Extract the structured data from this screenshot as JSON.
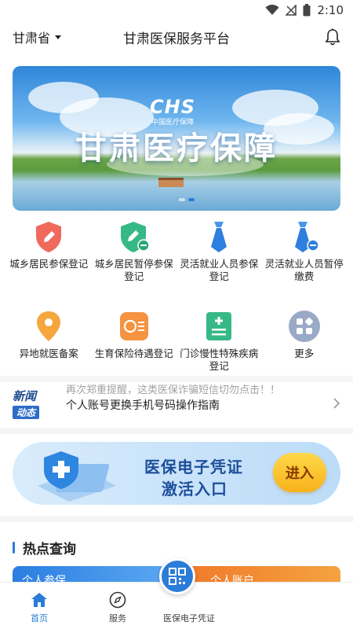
{
  "status_bar": {
    "time": "2:10"
  },
  "header": {
    "province": "甘肃省",
    "title": "甘肃医保服务平台"
  },
  "banner": {
    "logo_text": "CHS",
    "logo_subtitle": "中国医疗保障",
    "headline": "甘肃医疗保障"
  },
  "services": [
    {
      "label": "城乡居民参保登记",
      "icon": "shield-pen-icon",
      "color": "#e8564a"
    },
    {
      "label": "城乡居民暂停参保登记",
      "icon": "shield-pen-minus-icon",
      "color": "#2fb37a"
    },
    {
      "label": "灵活就业人员参保登记",
      "icon": "tie-icon",
      "color": "#2d7fe0"
    },
    {
      "label": "灵活就业人员暂停缴费",
      "icon": "tie-minus-icon",
      "color": "#2d7fe0"
    },
    {
      "label": "异地就医备案",
      "icon": "location-pin-icon",
      "color": "#f3a43a"
    },
    {
      "label": "生育保险待遇登记",
      "icon": "maternity-icon",
      "color": "#f38b34"
    },
    {
      "label": "门诊慢性特殊疾病登记",
      "icon": "clinic-list-icon",
      "color": "#2fb37a"
    },
    {
      "label": "更多",
      "icon": "more-grid-icon",
      "color": "#98a6c2"
    }
  ],
  "news": {
    "badge_top": "新闻",
    "badge_bottom": "动态",
    "items": [
      "再次郑重提醒，这类医保诈骗短信切勿点击！！",
      "个人账号更换手机号码操作指南"
    ]
  },
  "promo": {
    "line1": "医保电子凭证",
    "line2": "激活入口",
    "button": "进入"
  },
  "hot_query": {
    "title": "热点查询",
    "card_left": "个人参保",
    "card_right": "个人账户"
  },
  "tabbar": {
    "home": "首页",
    "service": "服务",
    "voucher": "医保电子凭证"
  },
  "colors": {
    "primary": "#2a7cd8"
  }
}
